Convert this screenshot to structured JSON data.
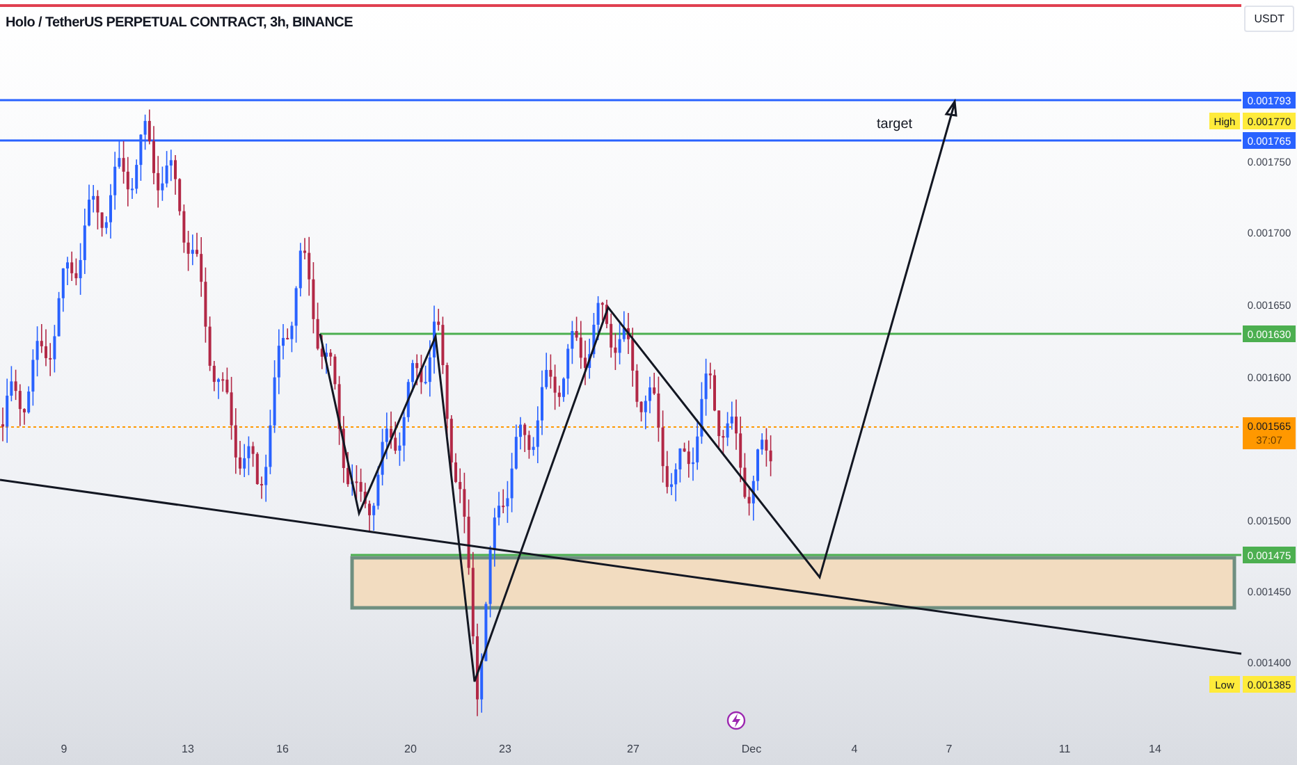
{
  "title": "Holo / TetherUS PERPETUAL CONTRACT, 3h, BINANCE",
  "currency_button": "USDT",
  "price_ticks": [
    "0.001750",
    "0.001700",
    "0.001650",
    "0.001600",
    "0.001500",
    "0.001450",
    "0.001400"
  ],
  "price_badges": [
    {
      "kind": "line",
      "value": "0.001793",
      "color": "#2962ff"
    },
    {
      "kind": "marker",
      "label": "High",
      "value": "0.001770",
      "color": "#ffeb3b"
    },
    {
      "kind": "line",
      "value": "0.001765",
      "color": "#2962ff"
    },
    {
      "kind": "line",
      "value": "0.001630",
      "color": "#4caf50"
    },
    {
      "kind": "price",
      "value": "0.001565",
      "countdown": "37:07",
      "color": "#ff9800"
    },
    {
      "kind": "line",
      "value": "0.001475",
      "color": "#4caf50"
    },
    {
      "kind": "marker",
      "label": "Low",
      "value": "0.001385",
      "color": "#ffeb3b"
    }
  ],
  "annotation": "target",
  "date_labels": [
    "9",
    "13",
    "16",
    "20",
    "23",
    "27",
    "Dec",
    "4",
    "7",
    "11",
    "14"
  ]
}
